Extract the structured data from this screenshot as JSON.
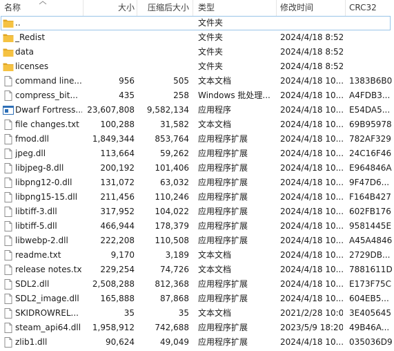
{
  "header": {
    "name": "名称",
    "size": "大小",
    "compressed": "压缩后大小",
    "type": "类型",
    "modified": "修改时间",
    "crc": "CRC32"
  },
  "rows": [
    {
      "icon": "folder-up-icon",
      "name": "..",
      "size": "",
      "csize": "",
      "type": "文件夹",
      "date": "",
      "crc": "",
      "selected": true
    },
    {
      "icon": "folder-icon",
      "name": "_Redist",
      "size": "",
      "csize": "",
      "type": "文件夹",
      "date": "2024/4/18 8:52",
      "crc": ""
    },
    {
      "icon": "folder-icon",
      "name": "data",
      "size": "",
      "csize": "",
      "type": "文件夹",
      "date": "2024/4/18 8:52",
      "crc": ""
    },
    {
      "icon": "folder-icon",
      "name": "licenses",
      "size": "",
      "csize": "",
      "type": "文件夹",
      "date": "2024/4/18 8:52",
      "crc": ""
    },
    {
      "icon": "document-icon",
      "name": "command line...",
      "size": "956",
      "csize": "505",
      "type": "文本文档",
      "date": "2024/4/18 10...",
      "crc": "1383B6B0"
    },
    {
      "icon": "document-icon",
      "name": "compress_bit...",
      "size": "435",
      "csize": "258",
      "type": "Windows 批处理...",
      "date": "2024/4/18 10...",
      "crc": "A4FDB3..."
    },
    {
      "icon": "application-icon",
      "name": "Dwarf Fortress...",
      "size": "23,607,808",
      "csize": "9,582,134",
      "type": "应用程序",
      "date": "2024/4/18 10...",
      "crc": "E54DA5..."
    },
    {
      "icon": "document-icon",
      "name": "file changes.txt",
      "size": "100,288",
      "csize": "31,582",
      "type": "文本文档",
      "date": "2024/4/18 10...",
      "crc": "69B95978"
    },
    {
      "icon": "document-icon",
      "name": "fmod.dll",
      "size": "1,849,344",
      "csize": "853,764",
      "type": "应用程序扩展",
      "date": "2024/4/18 10...",
      "crc": "782AF329"
    },
    {
      "icon": "document-icon",
      "name": "jpeg.dll",
      "size": "113,664",
      "csize": "59,262",
      "type": "应用程序扩展",
      "date": "2024/4/18 10...",
      "crc": "24C16F46"
    },
    {
      "icon": "document-icon",
      "name": "libjpeg-8.dll",
      "size": "200,192",
      "csize": "101,406",
      "type": "应用程序扩展",
      "date": "2024/4/18 10...",
      "crc": "E964846A"
    },
    {
      "icon": "document-icon",
      "name": "libpng12-0.dll",
      "size": "131,072",
      "csize": "63,032",
      "type": "应用程序扩展",
      "date": "2024/4/18 10...",
      "crc": "9F47D6..."
    },
    {
      "icon": "document-icon",
      "name": "libpng15-15.dll",
      "size": "211,456",
      "csize": "110,246",
      "type": "应用程序扩展",
      "date": "2024/4/18 10...",
      "crc": "F164B427"
    },
    {
      "icon": "document-icon",
      "name": "libtiff-3.dll",
      "size": "317,952",
      "csize": "104,022",
      "type": "应用程序扩展",
      "date": "2024/4/18 10...",
      "crc": "602FB176"
    },
    {
      "icon": "document-icon",
      "name": "libtiff-5.dll",
      "size": "466,944",
      "csize": "178,379",
      "type": "应用程序扩展",
      "date": "2024/4/18 10...",
      "crc": "9581445E"
    },
    {
      "icon": "document-icon",
      "name": "libwebp-2.dll",
      "size": "222,208",
      "csize": "110,508",
      "type": "应用程序扩展",
      "date": "2024/4/18 10...",
      "crc": "A45A4846"
    },
    {
      "icon": "document-icon",
      "name": "readme.txt",
      "size": "9,170",
      "csize": "3,189",
      "type": "文本文档",
      "date": "2024/4/18 10...",
      "crc": "2729DB..."
    },
    {
      "icon": "document-icon",
      "name": "release notes.txt",
      "size": "229,254",
      "csize": "74,726",
      "type": "文本文档",
      "date": "2024/4/18 10...",
      "crc": "7881611D"
    },
    {
      "icon": "document-icon",
      "name": "SDL2.dll",
      "size": "2,508,288",
      "csize": "812,368",
      "type": "应用程序扩展",
      "date": "2024/4/18 10...",
      "crc": "E173F75C"
    },
    {
      "icon": "document-icon",
      "name": "SDL2_image.dll",
      "size": "165,888",
      "csize": "87,868",
      "type": "应用程序扩展",
      "date": "2024/4/18 10...",
      "crc": "604EB5..."
    },
    {
      "icon": "document-icon",
      "name": "SKIDROWREL...",
      "size": "35",
      "csize": "35",
      "type": "文本文档",
      "date": "2021/2/28 10:0...",
      "crc": "3E405645"
    },
    {
      "icon": "document-icon",
      "name": "steam_api64.dll",
      "size": "1,958,912",
      "csize": "742,688",
      "type": "应用程序扩展",
      "date": "2023/5/9 18:20",
      "crc": "49B46A..."
    },
    {
      "icon": "document-icon",
      "name": "zlib1.dll",
      "size": "90,624",
      "csize": "49,049",
      "type": "应用程序扩展",
      "date": "2024/4/18 10...",
      "crc": "035036D9"
    }
  ],
  "colors": {
    "folder": "#f5c242",
    "folder_dark": "#e0a624",
    "selection_border": "#99c4e8",
    "app_icon_blue": "#2d6fb7"
  }
}
